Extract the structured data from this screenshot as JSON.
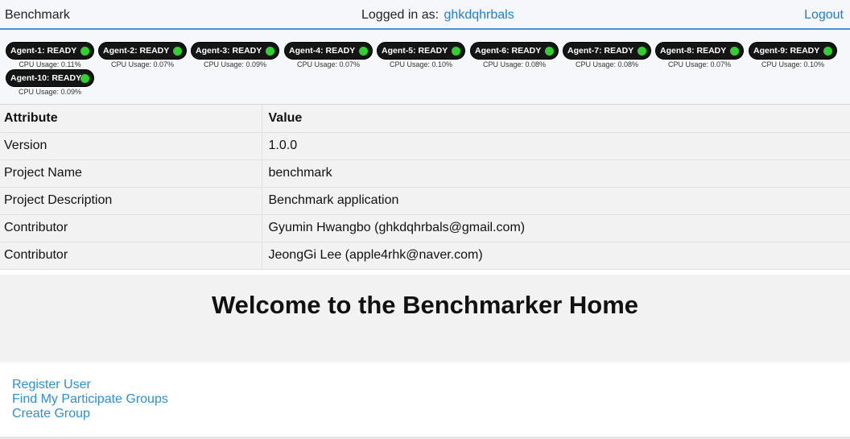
{
  "header": {
    "brand": "Benchmark",
    "logged_in_label": "Logged in as:",
    "username": "ghkdqhrbals",
    "logout": "Logout"
  },
  "agents": [
    {
      "name": "Agent-1: READY",
      "cpu": "CPU Usage: 0.11%"
    },
    {
      "name": "Agent-2: READY",
      "cpu": "CPU Usage: 0.07%"
    },
    {
      "name": "Agent-3: READY",
      "cpu": "CPU Usage: 0.09%"
    },
    {
      "name": "Agent-4: READY",
      "cpu": "CPU Usage: 0.07%"
    },
    {
      "name": "Agent-5: READY",
      "cpu": "CPU Usage: 0.10%"
    },
    {
      "name": "Agent-6: READY",
      "cpu": "CPU Usage: 0.08%"
    },
    {
      "name": "Agent-7: READY",
      "cpu": "CPU Usage: 0.08%"
    },
    {
      "name": "Agent-8: READY",
      "cpu": "CPU Usage: 0.07%"
    },
    {
      "name": "Agent-9: READY",
      "cpu": "CPU Usage: 0.10%"
    },
    {
      "name": "Agent-10: READY",
      "cpu": "CPU Usage: 0.09%"
    }
  ],
  "status_color": "#2fd12f",
  "table": {
    "headers": [
      "Attribute",
      "Value"
    ],
    "rows": [
      [
        "Version",
        "1.0.0"
      ],
      [
        "Project Name",
        "benchmark"
      ],
      [
        "Project Description",
        "Benchmark application"
      ],
      [
        "Contributor",
        "Gyumin Hwangbo (ghkdqhrbals@gmail.com)"
      ],
      [
        "Contributor",
        "JeongGi Lee (apple4rhk@naver.com)"
      ]
    ]
  },
  "welcome": "Welcome to the Benchmarker Home",
  "links": [
    "Register User",
    "Find My Participate Groups",
    "Create Group"
  ],
  "colors": {
    "link": "#2f8fd8",
    "accent_border": "#4a90d9"
  }
}
